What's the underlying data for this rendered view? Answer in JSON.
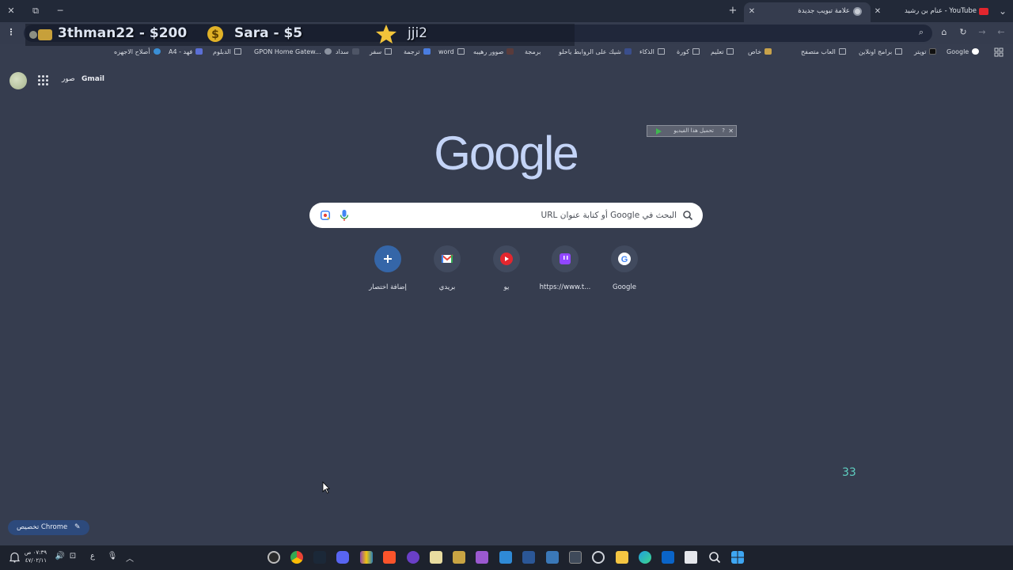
{
  "window": {
    "minimize": "─",
    "restore": "⧉",
    "close": "✕",
    "tab_search": "⌄"
  },
  "tabs": [
    {
      "label": "عنام بن رشيد - YouTube",
      "close": "✕",
      "icon": "youtube-icon",
      "active": false
    },
    {
      "label": "علامة تبويب جديدة",
      "close": "✕",
      "icon": "chrome-icon",
      "active": true
    }
  ],
  "new_tab": "+",
  "toolbar": {
    "back": "←",
    "forward": "→",
    "reload": "↻",
    "home": "⌂",
    "menu": "⋮",
    "search": "⌕"
  },
  "donations": {
    "first": "3thman22 - $200",
    "second": "Sara - $5",
    "third": "jji2"
  },
  "bookmarks": [
    {
      "label": "Google",
      "icon": "google-icon"
    },
    {
      "label": "تويتر",
      "icon": "x-icon"
    },
    {
      "label": "برامج اونلاين",
      "icon": "folder-icon"
    },
    {
      "label": "العاب متصفح",
      "icon": "folder-icon"
    },
    {
      "label": "خاص",
      "icon": "favicon-icon"
    },
    {
      "label": "تعليم",
      "icon": "folder-icon"
    },
    {
      "label": "كورة",
      "icon": "folder-icon"
    },
    {
      "label": "الذكاء",
      "icon": "folder-icon"
    },
    {
      "label": "شيك على الروابط ياحلو",
      "icon": "favicon-icon"
    },
    {
      "label": "برمجة",
      "icon": "folder-icon"
    },
    {
      "label": "صوور رهيبه",
      "icon": "favicon-icon"
    },
    {
      "label": "word",
      "icon": "folder-icon"
    },
    {
      "label": "ترجمة",
      "icon": "favicon-icon"
    },
    {
      "label": "سفر",
      "icon": "folder-icon"
    },
    {
      "label": "سداد",
      "icon": "favicon-icon"
    },
    {
      "label": "GPON Home Gatew...",
      "icon": "globe-icon"
    },
    {
      "label": "الدبلوم",
      "icon": "folder-icon"
    },
    {
      "label": "A4 - فهد",
      "icon": "favicon-icon"
    },
    {
      "label": "أصلاح الاجهزه",
      "icon": "favicon-icon"
    }
  ],
  "ntp": {
    "gmail": "Gmail",
    "images": "صور",
    "logo": "Google",
    "popup_text": "تحميل هذا الفيديو",
    "search_placeholder": "البحث في Google أو كتابة عنوان URL",
    "counter": "33",
    "customize": "تخصيص Chrome",
    "shortcuts": [
      {
        "label": "Google",
        "icon": "google-g-icon"
      },
      {
        "label": "https://www.t...",
        "icon": "twitch-icon"
      },
      {
        "label": "يو",
        "icon": "youtube-icon"
      },
      {
        "label": "بريدي",
        "icon": "gmail-icon"
      },
      {
        "label": "إضافة اختصار",
        "icon": "plus-icon"
      }
    ]
  },
  "taskbar": {
    "time": "٠٧:٣٩ ص",
    "date": "٤٧/٠٢/١١",
    "lang": "ع",
    "apps": [
      "obs-icon",
      "chrome-icon",
      "steam-icon",
      "discord-icon",
      "winrar-icon",
      "brave-icon",
      "app-icon",
      "notepad-icon",
      "store-icon",
      "feather-icon",
      "notes-icon",
      "word-icon",
      "calculator-icon",
      "excel-icon",
      "chatgpt-icon",
      "explorer-icon",
      "edge-icon",
      "outlook-icon",
      "taskview-icon",
      "search-icon",
      "start-icon"
    ]
  },
  "colors": {
    "page_bg": "#363d4f",
    "tabbar_bg": "#222938",
    "accent": "#2d4a7c",
    "counter": "#5fd0c2"
  }
}
